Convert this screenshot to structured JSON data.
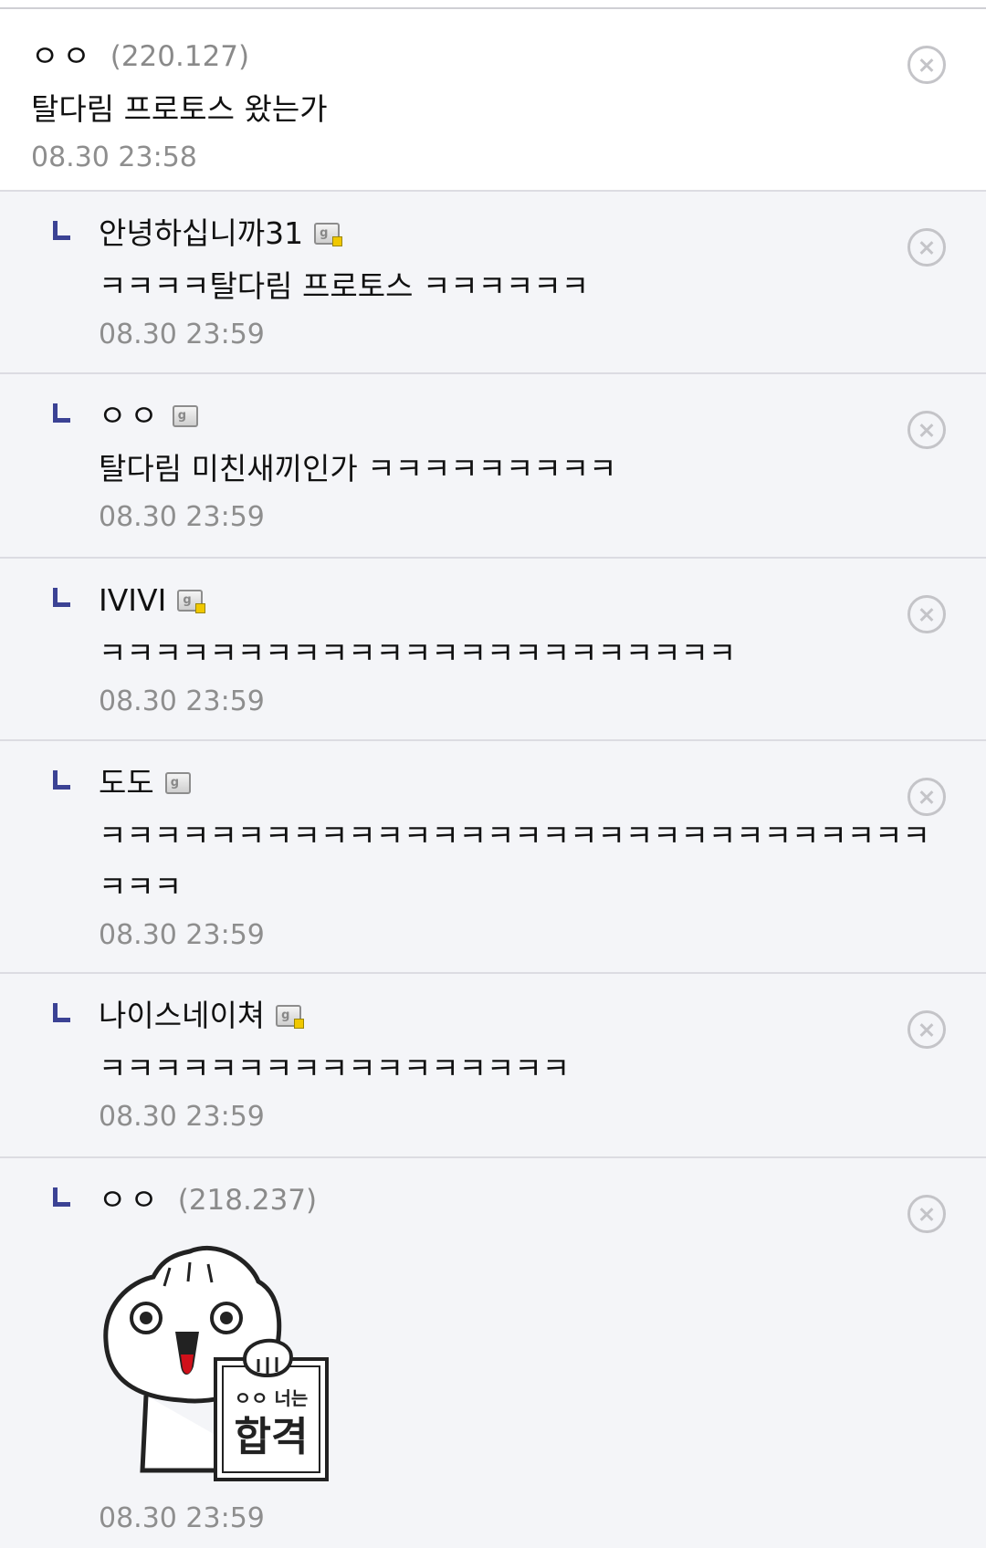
{
  "comments": [
    {
      "nick": "ㅇㅇ",
      "ip": "(220.127)",
      "text": "탈다림 프로토스 왔는가",
      "time": "08.30 23:58"
    },
    {
      "nick": "안녕하십니까31",
      "text": "ㅋㅋㅋㅋ탈다림 프로토스 ㅋㅋㅋㅋㅋㅋ",
      "time": "08.30 23:59"
    },
    {
      "nick": "ㅇㅇ",
      "text": "탈다림 미친새끼인가 ㅋㅋㅋㅋㅋㅋㅋㅋㅋ",
      "time": "08.30 23:59"
    },
    {
      "nick": "IVIVI",
      "text": "ㅋㅋㅋㅋㅋㅋㅋㅋㅋㅋㅋㅋㅋㅋㅋㅋㅋㅋㅋㅋㅋㅋㅋ",
      "time": "08.30 23:59"
    },
    {
      "nick": "도도",
      "text": "ㅋㅋㅋㅋㅋㅋㅋㅋㅋㅋㅋㅋㅋㅋㅋㅋㅋㅋㅋㅋㅋㅋㅋㅋㅋㅋㅋㅋㅋㅋㅋㅋㅋ",
      "time": "08.30 23:59"
    },
    {
      "nick": "나이스네이쳐",
      "text": "ㅋㅋㅋㅋㅋㅋㅋㅋㅋㅋㅋㅋㅋㅋㅋㅋㅋ",
      "time": "08.30 23:59"
    },
    {
      "nick": "ㅇㅇ",
      "ip": "(218.237)",
      "sticker_text_small": "ㅇㅇ 너는",
      "sticker_text_big": "합격",
      "time": "08.30 23:59"
    }
  ],
  "icons": {
    "reply": "reply-arrow-icon",
    "delete": "delete-circle-x-icon",
    "badge": "gallery-member-badge-icon"
  },
  "colors": {
    "reply_bg": "#f4f5f8",
    "reply_mark": "#3b4294",
    "meta_gray": "#8e8e8e"
  }
}
